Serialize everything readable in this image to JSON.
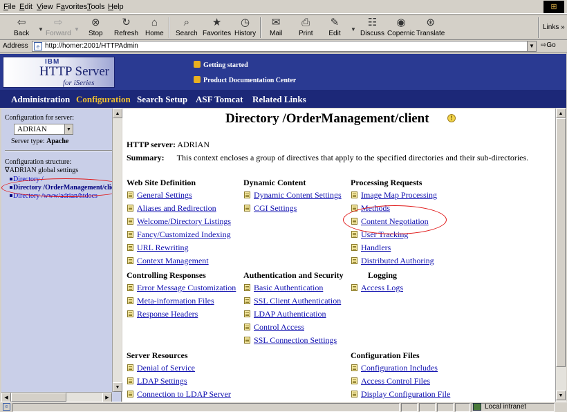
{
  "menu": {
    "items": [
      {
        "pre": "",
        "ul": "F",
        "post": "ile"
      },
      {
        "pre": "",
        "ul": "E",
        "post": "dit"
      },
      {
        "pre": "",
        "ul": "V",
        "post": "iew"
      },
      {
        "pre": "F",
        "ul": "a",
        "post": "vorites"
      },
      {
        "pre": "",
        "ul": "T",
        "post": "ools"
      },
      {
        "pre": "",
        "ul": "H",
        "post": "elp"
      }
    ]
  },
  "toolbar": {
    "back": "Back",
    "forward": "Forward",
    "stop": "Stop",
    "refresh": "Refresh",
    "home": "Home",
    "search": "Search",
    "favorites": "Favorites",
    "history": "History",
    "mail": "Mail",
    "print": "Print",
    "edit": "Edit",
    "discuss": "Discuss",
    "copernic": "Copernic",
    "translate": "Translate",
    "links": "Links",
    "links_chevron": "»"
  },
  "address": {
    "label": "Address",
    "url": "http://homer:2001/HTTPAdmin",
    "go": "Go"
  },
  "banner": {
    "logo_ibm": "IBM",
    "logo_http": "HTTP Server",
    "logo_for": "for iSeries",
    "link_getting_started": "Getting started",
    "link_product_docs": "Product Documentation Center"
  },
  "nav": {
    "administration": "Administration",
    "configuration": "Configuration",
    "search_setup": "Search Setup",
    "asf_tomcat": "ASF Tomcat",
    "related_links": "Related Links"
  },
  "left": {
    "config_for_server": "Configuration for server:",
    "server_value": "ADRIAN",
    "server_type_label": "Server type:",
    "server_type_value": "Apache",
    "config_structure": "Configuration structure:",
    "tree_root": "∇ADRIAN global settings",
    "tree_items": [
      "Directory /",
      "Directory /OrderManagement/clie",
      "Directory /www/adrian/htdocs"
    ]
  },
  "main": {
    "title": "Directory /OrderManagement/client",
    "http_server_label": "HTTP server:",
    "http_server_value": "ADRIAN",
    "summary_label": "Summary:",
    "summary_text": "This context encloses a group of directives that apply to the specified directories and their sub-directories.",
    "sections": {
      "web_site_definition": {
        "title": "Web Site Definition",
        "links": [
          "General Settings",
          "Aliases and Redirection",
          "Welcome/Directory Listings",
          "Fancy/Customized Indexing",
          "URL Rewriting",
          "Context Management"
        ]
      },
      "dynamic_content": {
        "title": "Dynamic Content",
        "links": [
          "Dynamic Content Settings",
          "CGI Settings"
        ]
      },
      "processing_requests": {
        "title": "Processing Requests",
        "links": [
          "Image Map Processing",
          "Methods",
          "Content Negotiation",
          "User Tracking",
          "Handlers",
          "Distributed Authoring"
        ]
      },
      "controlling_responses": {
        "title": "Controlling Responses",
        "links": [
          "Error Message Customization",
          "Meta-information Files",
          "Response Headers"
        ]
      },
      "authentication_security": {
        "title": "Authentication and Security",
        "links": [
          "Basic Authentication",
          "SSL Client Authentication",
          "LDAP Authentication",
          "Control Access",
          "SSL Connection Settings"
        ]
      },
      "logging": {
        "title": "Logging",
        "links": [
          "Access Logs"
        ]
      },
      "server_resources": {
        "title": "Server Resources",
        "links": [
          "Denial of Service",
          "LDAP Settings",
          "Connection to LDAP Server"
        ]
      },
      "configuration_files": {
        "title": "Configuration Files",
        "links": [
          "Configuration Includes",
          "Access Control Files",
          "Display Configuration File"
        ]
      }
    }
  },
  "status": {
    "zone": "Local intranet"
  },
  "colors": {
    "banner": "#2a3a92",
    "nav_bar": "#1c2878",
    "nav_active": "#f0c030",
    "left_frame": "#c9cfe8",
    "link": "#1010b0",
    "highlight_oval": "#e01818"
  },
  "icons": [
    "back-arrow-icon",
    "forward-arrow-icon",
    "stop-icon",
    "refresh-icon",
    "home-icon",
    "search-icon",
    "favorites-icon",
    "history-icon",
    "mail-icon",
    "print-icon",
    "edit-icon",
    "discuss-icon",
    "copernic-icon",
    "translate-icon",
    "page-icon",
    "help-lightbulb-icon",
    "intranet-zone-icon"
  ]
}
